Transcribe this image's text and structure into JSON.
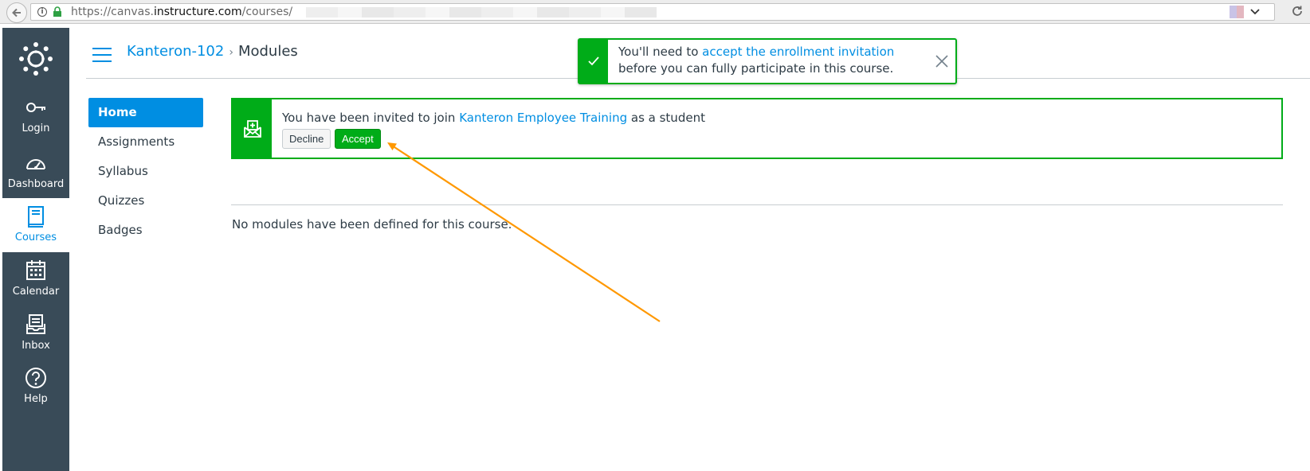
{
  "browser": {
    "url_prefix": "https://canvas.",
    "url_domain": "instructure.com",
    "url_path": "/courses/"
  },
  "global_nav": {
    "items": [
      {
        "label": "Login",
        "icon": "key-icon"
      },
      {
        "label": "Dashboard",
        "icon": "dashboard-icon"
      },
      {
        "label": "Courses",
        "icon": "courses-icon",
        "active": true
      },
      {
        "label": "Calendar",
        "icon": "calendar-icon"
      },
      {
        "label": "Inbox",
        "icon": "inbox-icon"
      },
      {
        "label": "Help",
        "icon": "help-icon"
      }
    ]
  },
  "breadcrumb": {
    "course": "Kanteron-102",
    "separator": "›",
    "current": "Modules"
  },
  "course_nav": {
    "items": [
      {
        "label": "Home",
        "active": true
      },
      {
        "label": "Assignments"
      },
      {
        "label": "Syllabus"
      },
      {
        "label": "Quizzes"
      },
      {
        "label": "Badges"
      }
    ]
  },
  "invitation": {
    "text_before": "You have been invited to join ",
    "course_link": "Kanteron Employee Training",
    "text_after": " as a student",
    "decline_label": "Decline",
    "accept_label": "Accept"
  },
  "flash": {
    "text_before": "You'll need to ",
    "link": "accept the enrollment invitation",
    "text_after": " before you can fully participate in this course."
  },
  "modules": {
    "empty_message": "No modules have been defined for this course."
  },
  "colors": {
    "brand_blue": "#008ee2",
    "success_green": "#00ac18",
    "nav_bg": "#394b58",
    "annotation_orange": "#ff9800"
  }
}
